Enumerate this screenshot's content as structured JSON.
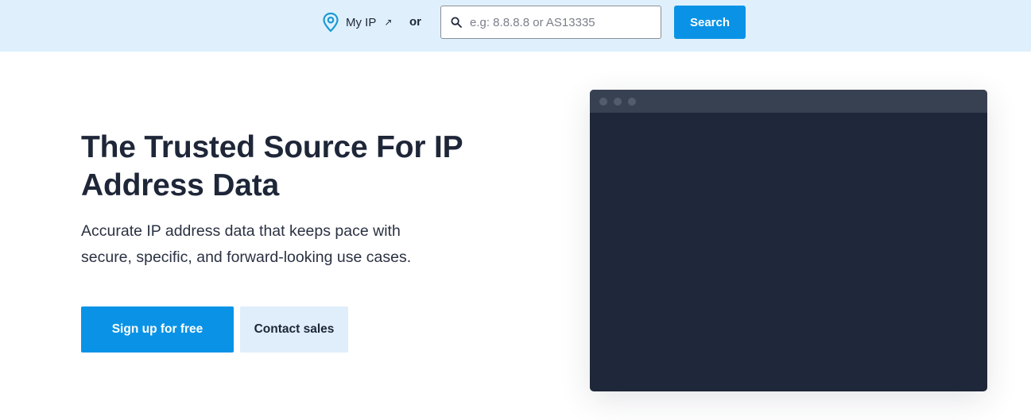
{
  "topbar": {
    "myip_label": "My IP",
    "myip_arrow": "↗",
    "or_label": "or",
    "search_placeholder": "e.g: 8.8.8.8 or AS13335",
    "search_value": "",
    "search_button": "Search"
  },
  "hero": {
    "title": "The Trusted Source For IP Address Data",
    "subtitle": "Accurate IP address data that keeps pace with secure, specific, and forward-looking use cases.",
    "primary_cta": "Sign up for free",
    "secondary_cta": "Contact sales"
  },
  "icons": {
    "myip": "map-pin-icon",
    "search": "magnifier-icon",
    "arrow": "external-arrow-icon"
  },
  "colors": {
    "topbar_bg": "#dff0fc",
    "accent": "#0a93e6",
    "text": "#1e2638",
    "secondary_btn_bg": "#dfeefa",
    "mockup_bg": "#1f273a",
    "mockup_bar": "#384152"
  }
}
